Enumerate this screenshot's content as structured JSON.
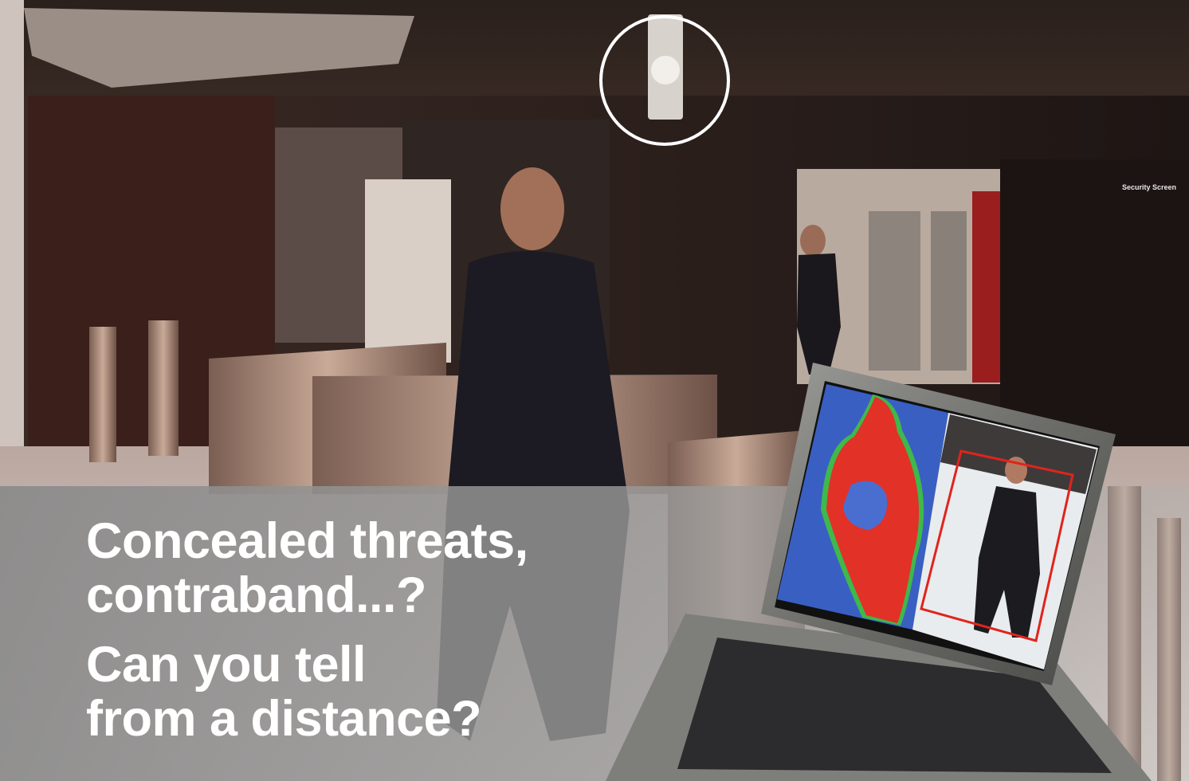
{
  "headline": {
    "question_1": {
      "line_1": "Concealed threats,",
      "line_2": "contraband...?"
    },
    "question_2": {
      "line_1": "Can you tell",
      "line_2": "from a distance?"
    }
  },
  "signage": {
    "security_screening": "Security Screen"
  },
  "laptop_screen": {
    "left_panel": "thermal-style body scan",
    "right_panel": "camera view with detection box",
    "colors": {
      "background": "#3a5fc2",
      "body": "#e23126",
      "edge": "#3fb84c",
      "anomaly": "#4a6ed0",
      "detection_box": "#e0241c"
    }
  },
  "colors": {
    "overlay_band": "#8c8c8c",
    "text": "#ffffff",
    "highlight_circle": "#ffffff"
  }
}
